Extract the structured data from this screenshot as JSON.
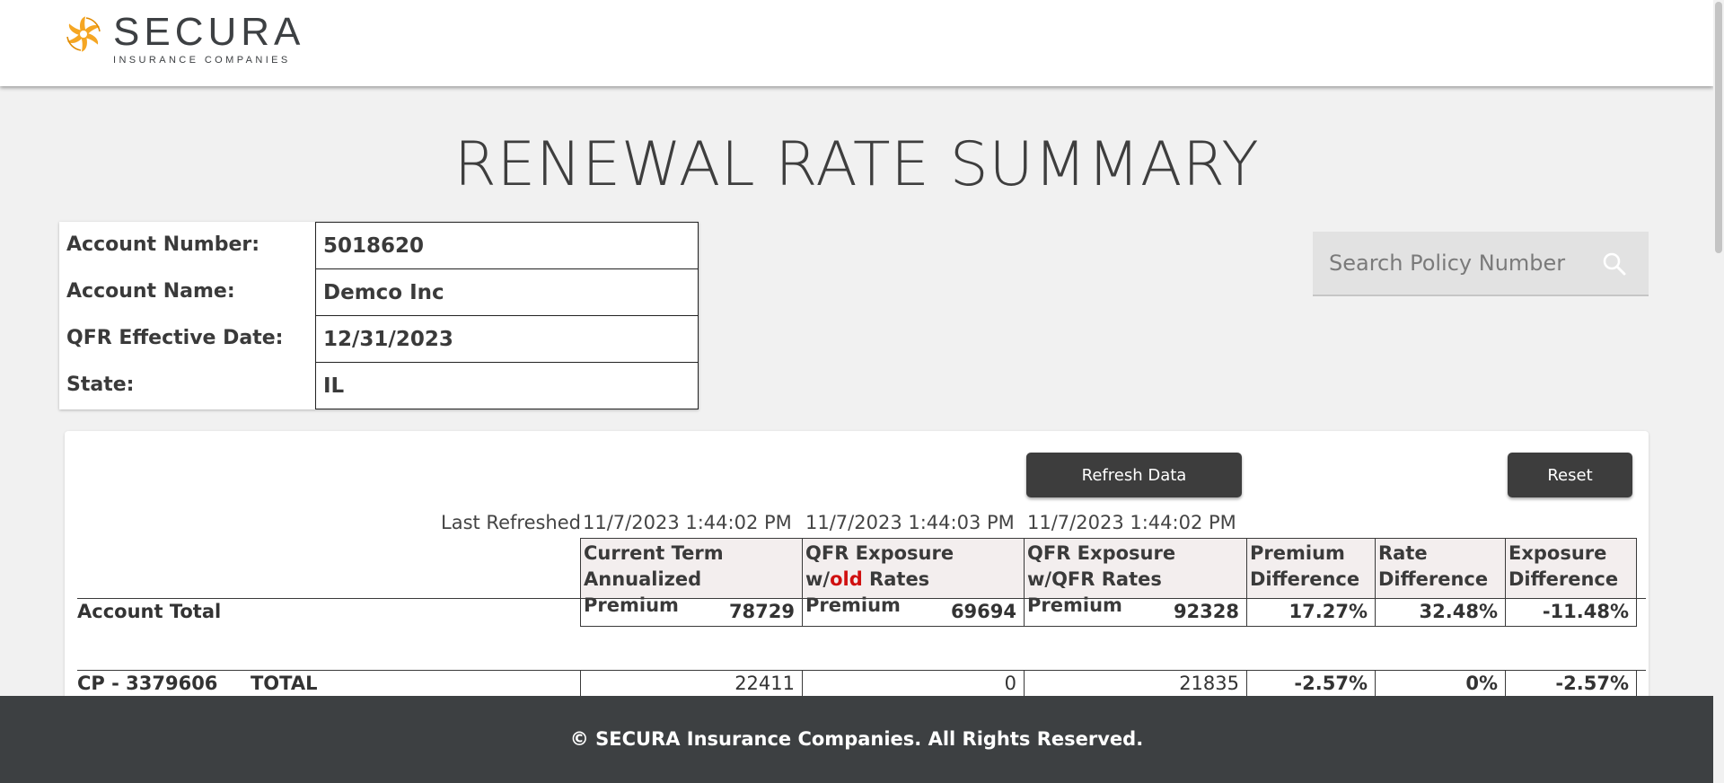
{
  "header": {
    "logo_word": "SECURA",
    "logo_sub": "INSURANCE COMPANIES"
  },
  "page_title": "RENEWAL RATE SUMMARY",
  "account": {
    "rows": [
      {
        "label": "Account Number:",
        "value": "5018620"
      },
      {
        "label": "Account Name:",
        "value": "Demco Inc"
      },
      {
        "label": "QFR Effective Date:",
        "value": "12/31/2023"
      },
      {
        "label": "State:",
        "value": "IL"
      }
    ]
  },
  "search": {
    "placeholder": "Search Policy Number",
    "icon": "search-icon"
  },
  "actions": {
    "refresh_label": "Refresh Data",
    "reset_label": "Reset"
  },
  "table": {
    "last_refreshed_label": "Last Refreshed",
    "refreshed_times": [
      "11/7/2023 1:44:02 PM",
      "11/7/2023 1:44:03 PM",
      "11/7/2023 1:44:02 PM"
    ],
    "headers": {
      "current_line1": "Current Term",
      "current_line2": "Annualized Premium",
      "old_line1": "QFR Exposure",
      "old_prefix": "w/",
      "old_word": "old",
      "old_suffix": " Rates Premium",
      "qfr_line1": "QFR Exposure",
      "qfr_line2": "w/QFR Rates Premium",
      "prem_line1": "Premium",
      "prem_line2": "Difference",
      "rate_line1": "Rate",
      "rate_line2": "Difference",
      "exp_line1": "Exposure",
      "exp_line2": "Difference"
    },
    "rows": [
      {
        "label": "Account Total",
        "values": [
          "78729",
          "69694",
          "92328",
          "17.27%",
          "32.48%",
          "-11.48%"
        ]
      },
      {
        "label": "CP - 3379606     TOTAL",
        "values": [
          "22411",
          "0",
          "21835",
          "-2.57%",
          "0%",
          "-2.57%"
        ]
      }
    ]
  },
  "footer": {
    "copyright": "© SECURA Insurance Companies. All Rights Reserved."
  },
  "colors": {
    "header_bg": "#ffffff",
    "page_bg": "#f1f1f1",
    "button_bg": "#3d3d3d",
    "footer_bg": "#3d4042",
    "accent_logo": "#f5a623",
    "old_highlight": "#d01010"
  }
}
